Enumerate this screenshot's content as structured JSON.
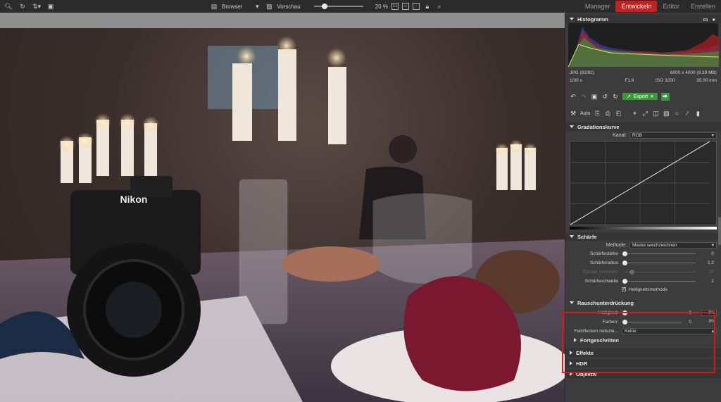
{
  "toolbar": {
    "browser_label": "Browser",
    "preview_label": "Vorschau",
    "zoom": "20 %",
    "zoom_fraction": 0.22,
    "fit_label": "1:1"
  },
  "modes": [
    "Manager",
    "Entwickeln",
    "Editor",
    "Erstellen"
  ],
  "active_mode": "Entwickeln",
  "histogram": {
    "title": "Histogramm",
    "format": "JPG",
    "index": "(82/82)",
    "dimensions": "6000 x 4000 (9.39 MB)",
    "shutter": "1/30 s",
    "aperture": "F1.8",
    "iso": "ISO 3200",
    "focal": "35.00 mm"
  },
  "actions": {
    "export_label": "Export"
  },
  "tools": {
    "auto_label": "Auto"
  },
  "gradation": {
    "title": "Gradationskurve",
    "kanal_label": "Kanal:",
    "kanal_value": "RGB"
  },
  "schaerfe": {
    "title": "Schärfe",
    "method_label": "Methode:",
    "method_value": "Maske weichzeichnen",
    "params": [
      {
        "label": "Schärfestärke",
        "value": "0",
        "level": 0.0,
        "dim": false
      },
      {
        "label": "Schärferadius",
        "value": "1.2",
        "level": 0.0,
        "dim": false
      },
      {
        "label": "Ränder erkennen",
        "value": "25",
        "level": 0.1,
        "dim": true
      },
      {
        "label": "Schärfeschwelle",
        "value": "2",
        "level": 0.0,
        "dim": false
      }
    ],
    "check_label": "Helligkeitsmethode"
  },
  "noise": {
    "title": "Rauschunterdrückung",
    "params": [
      {
        "label": "Helligkeit:",
        "value": "0",
        "pct": "0%"
      },
      {
        "label": "Farben:",
        "value": "0",
        "pct": "0%"
      }
    ],
    "color_spots_label": "Farbflecken reduzie...",
    "color_spots_value": "Keine",
    "advanced_label": "Fortgeschritten"
  },
  "sections": [
    "Effekte",
    "HDR",
    "Objektiv"
  ],
  "colors": {
    "accent_red": "#c82020",
    "export_green": "#3a9a3a",
    "highlight_border": "#e01616"
  }
}
